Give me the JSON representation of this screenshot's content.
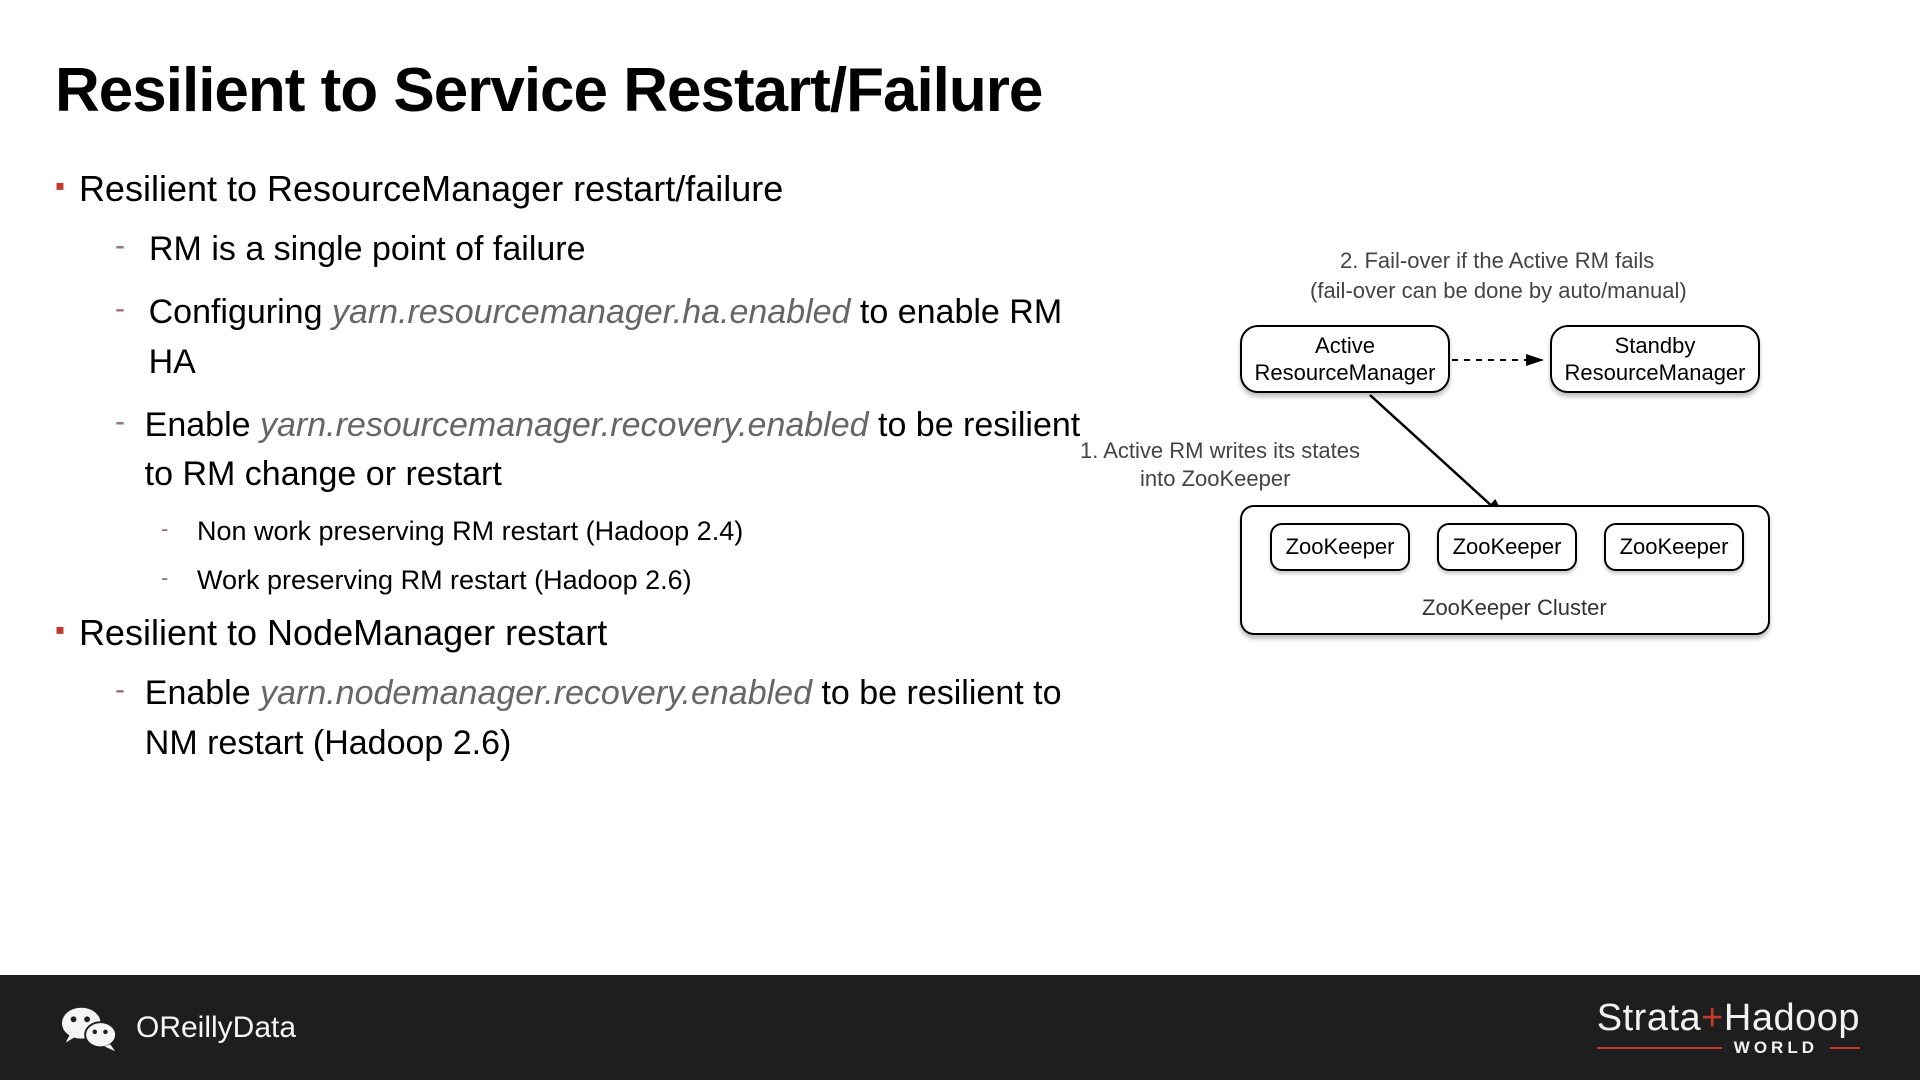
{
  "title": "Resilient to Service Restart/Failure",
  "section1": {
    "heading": "Resilient to ResourceManager restart/failure",
    "b1": "RM is a single point of failure",
    "b2a": "Configuring ",
    "b2code": "yarn.resourcemanager.ha.enabled",
    "b2b": " to enable RM HA",
    "b3a": "Enable ",
    "b3code": "yarn.resourcemanager.recovery.enabled",
    "b3b": " to be resilient to RM change or restart",
    "b3_1": "Non work preserving RM restart (Hadoop 2.4)",
    "b3_2": "Work preserving RM restart (Hadoop 2.6)"
  },
  "section2": {
    "heading": "Resilient to NodeManager restart",
    "b1a": "Enable ",
    "b1code": "yarn.nodemanager.recovery.enabled",
    "b1b": " to be resilient to NM restart (Hadoop 2.6)"
  },
  "diagram": {
    "caption2a": "2. Fail-over if the Active RM fails",
    "caption2b": "(fail-over can be done by auto/manual)",
    "caption1a": "1. Active RM writes its states",
    "caption1b": "into ZooKeeper",
    "active": "Active\nResourceManager",
    "standby": "Standby\nResourceManager",
    "zk": "ZooKeeper",
    "zkcluster": "ZooKeeper Cluster"
  },
  "footer": {
    "left": "OReillyData",
    "strata": "Strata",
    "plus": "+",
    "hadoop": "Hadoop",
    "world": "WORLD"
  }
}
